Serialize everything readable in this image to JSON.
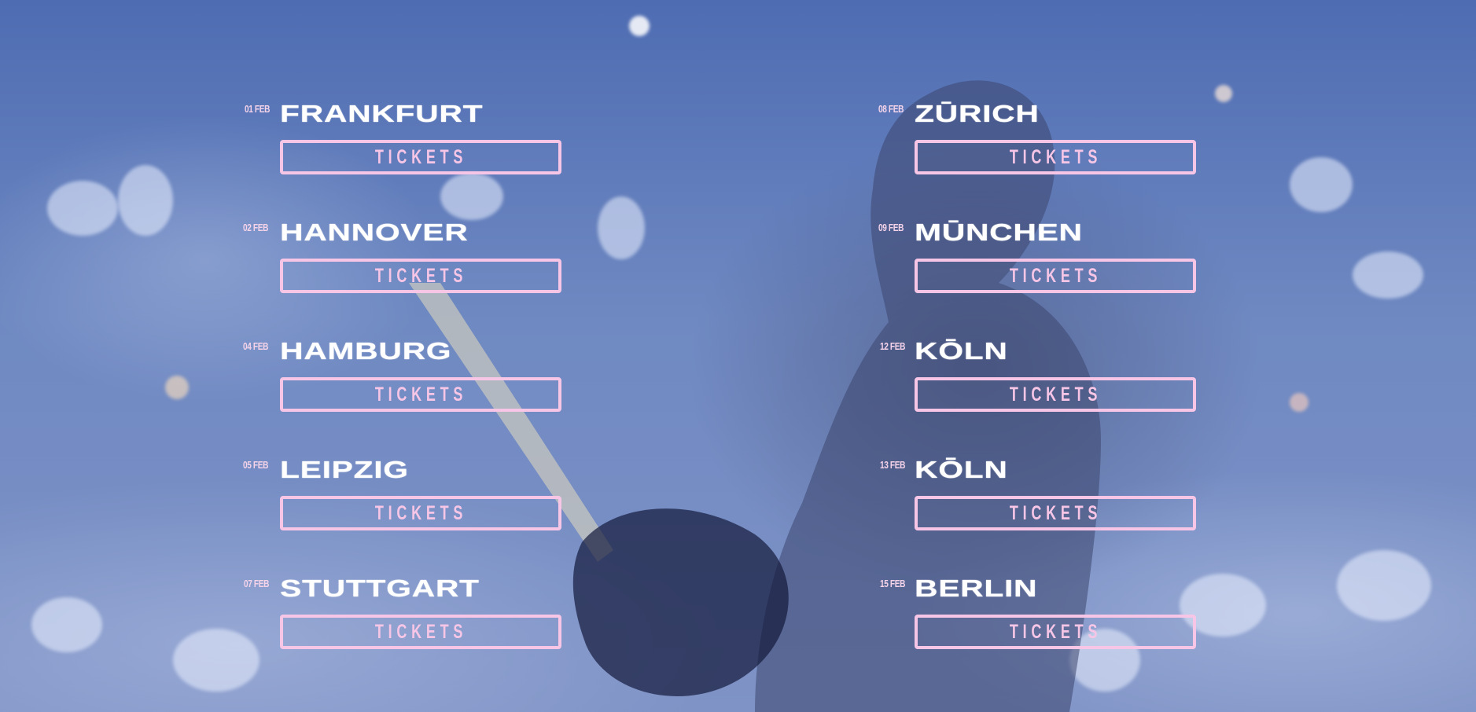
{
  "tour": {
    "left_column": [
      {
        "date": "01 FEB",
        "city": "FRANKFURT",
        "button_label": "TICKETS"
      },
      {
        "date": "02 FEB",
        "city": "HANNOVER",
        "button_label": "TICKETS"
      },
      {
        "date": "04 FEB",
        "city": "HAMBURG",
        "button_label": "TICKETS"
      },
      {
        "date": "05 FEB",
        "city": "LEIPZIG",
        "button_label": "TICKETS"
      },
      {
        "date": "07 FEB",
        "city": "STUTTGART",
        "button_label": "TICKETS"
      }
    ],
    "right_column": [
      {
        "date": "08 FEB",
        "city": "ZŪRICH",
        "button_label": "TICKETS"
      },
      {
        "date": "09 FEB",
        "city": "MŪNCHEN",
        "button_label": "TICKETS"
      },
      {
        "date": "12 FEB",
        "city": "KŌLN",
        "button_label": "TICKETS"
      },
      {
        "date": "13 FEB",
        "city": "KŌLN",
        "button_label": "TICKETS"
      },
      {
        "date": "15 FEB",
        "city": "BERLIN",
        "button_label": "TICKETS"
      }
    ]
  },
  "colors": {
    "accent": "#f7c6e6",
    "city_text": "#ffffff",
    "background_tint": "#5a76b6"
  }
}
